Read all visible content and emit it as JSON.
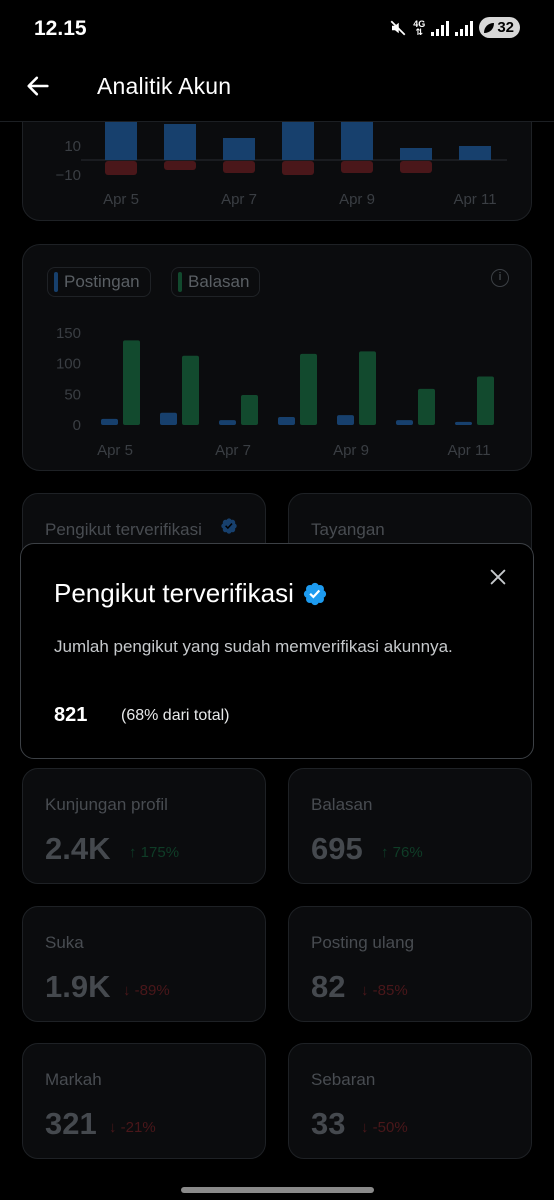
{
  "status_bar": {
    "time": "12.15",
    "network": "4G",
    "battery": "32"
  },
  "header": {
    "title": "Analitik Akun"
  },
  "chart_top": {
    "y_ticks": [
      "10",
      "−10"
    ],
    "x_ticks": [
      "Apr 5",
      "Apr 7",
      "Apr 9",
      "Apr 11"
    ]
  },
  "chart_data": {
    "type": "bar",
    "categories": [
      "Apr 5",
      "Apr 6",
      "Apr 7",
      "Apr 8",
      "Apr 9",
      "Apr 10",
      "Apr 11"
    ],
    "x_ticks": [
      "Apr 5",
      "Apr 7",
      "Apr 9",
      "Apr 11"
    ],
    "y_ticks": [
      "150",
      "100",
      "50",
      "0"
    ],
    "ylim": [
      0,
      150
    ],
    "series": [
      {
        "name": "Postingan",
        "color": "#17406d",
        "values": [
          10,
          20,
          8,
          13,
          16,
          8,
          5
        ]
      },
      {
        "name": "Balasan",
        "color": "#124a2e",
        "values": [
          138,
          113,
          49,
          116,
          120,
          59,
          79
        ]
      }
    ],
    "legend_position": "top-left"
  },
  "stats": {
    "verified_followers": {
      "label": "Pengikut terverifikasi"
    },
    "impressions": {
      "label": "Tayangan"
    },
    "profile_visits": {
      "label": "Kunjungan profil",
      "value": "2.4K",
      "change": "↑ 175%"
    },
    "replies": {
      "label": "Balasan",
      "value": "695",
      "change": "↑ 76%"
    },
    "likes": {
      "label": "Suka",
      "value": "1.9K",
      "change": "↓ -89%"
    },
    "reposts": {
      "label": "Posting ulang",
      "value": "82",
      "change": "↓ -85%"
    },
    "bookmarks": {
      "label": "Markah",
      "value": "321",
      "change": "↓ -21%"
    },
    "shares": {
      "label": "Sebaran",
      "value": "33",
      "change": "↓ -50%"
    }
  },
  "popup": {
    "title": "Pengikut terverifikasi",
    "description": "Jumlah pengikut yang sudah memverifikasi akunnya.",
    "count": "821",
    "percent": "(68% dari total)"
  },
  "colors": {
    "accent": "#1d9bf0",
    "up": "#00ba7c",
    "down": "#f4212e"
  }
}
